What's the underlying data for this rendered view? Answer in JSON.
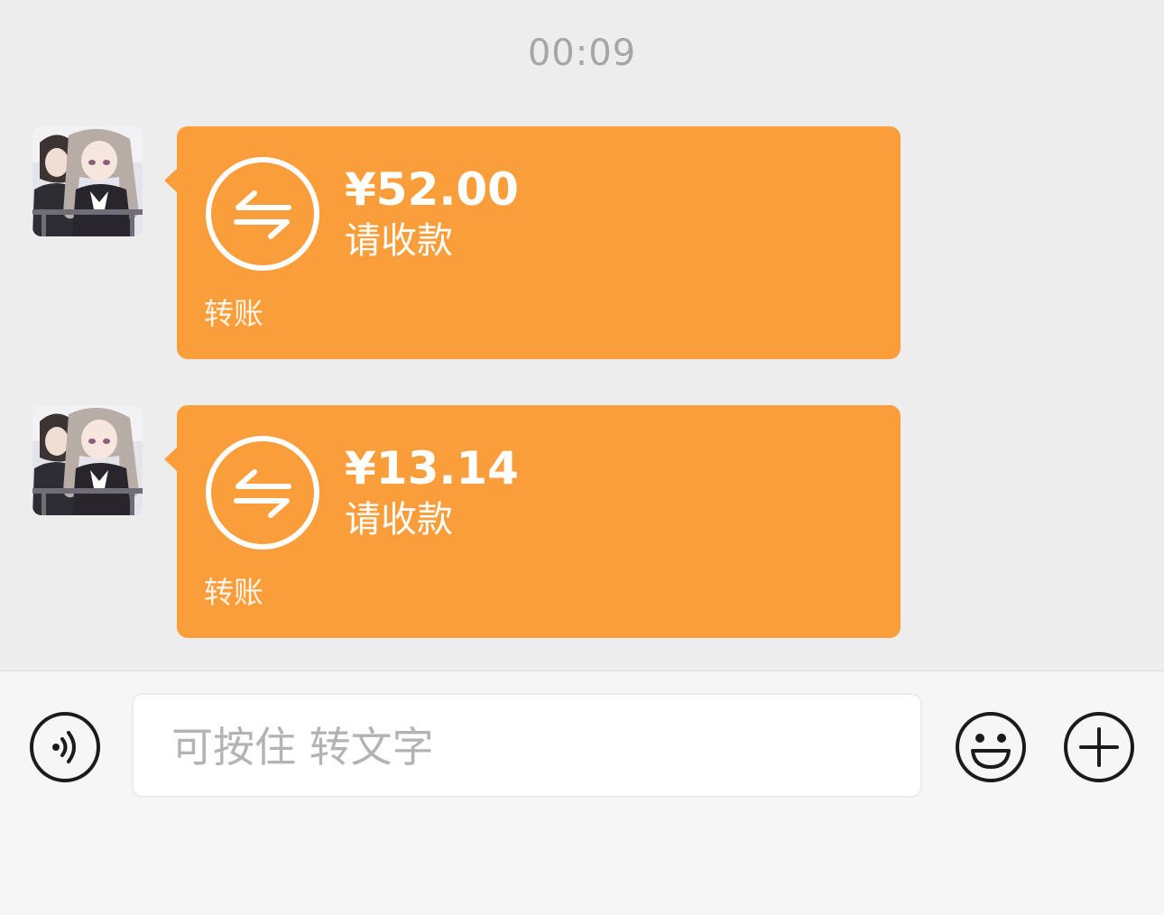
{
  "chat": {
    "timestamp": "00:09",
    "messages": [
      {
        "amount": "¥52.00",
        "status": "请收款",
        "type_label": "转账"
      },
      {
        "amount": "¥13.14",
        "status": "请收款",
        "type_label": "转账"
      }
    ]
  },
  "input_bar": {
    "placeholder": "可按住 转文字",
    "left_icon": "voice-icon",
    "right_icons": [
      "emoji-icon",
      "plus-icon"
    ]
  },
  "colors": {
    "background": "#ededed",
    "bubble": "#fa9d3b",
    "input_bar": "#f6f6f6",
    "timestamp": "#a6a6a6",
    "placeholder": "#b3b3b3"
  }
}
